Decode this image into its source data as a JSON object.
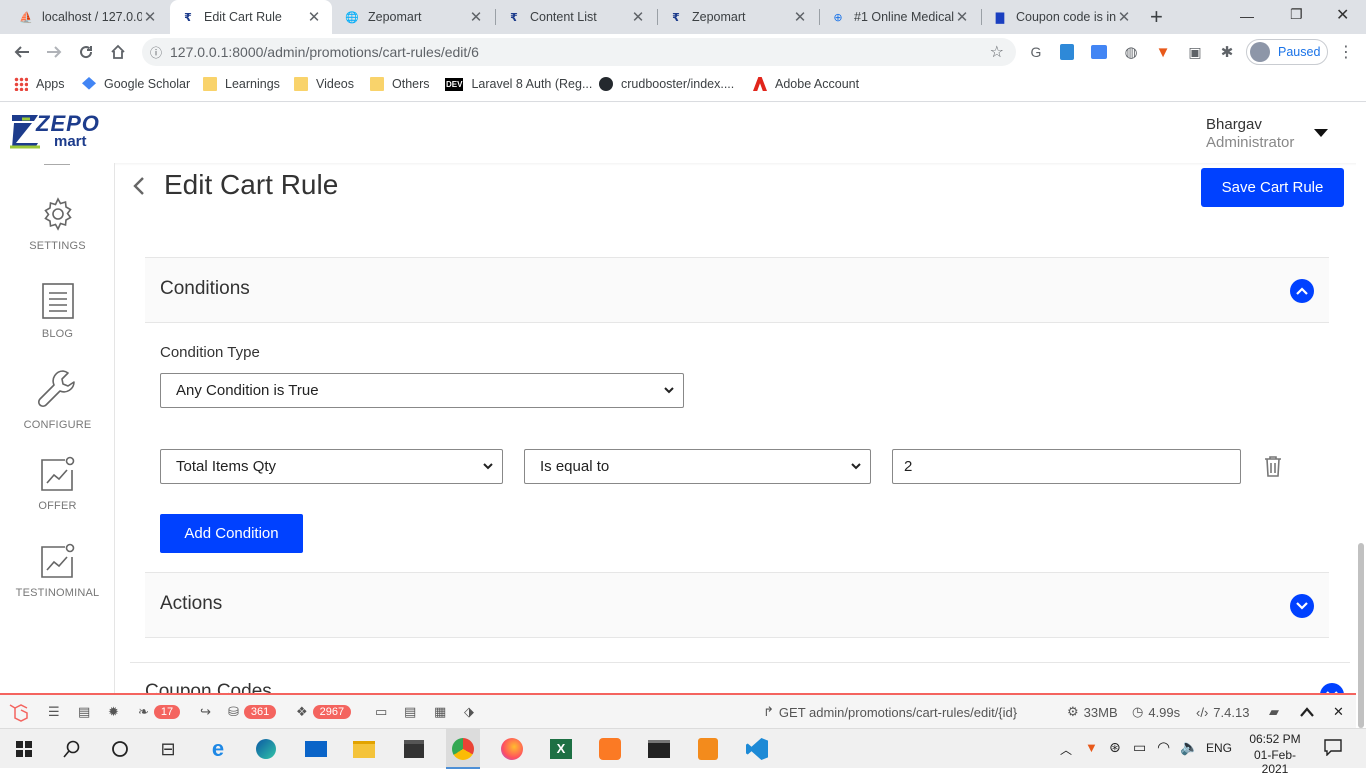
{
  "browser": {
    "tabs": [
      {
        "title": "localhost / 127.0.0."
      },
      {
        "title": "Edit Cart Rule"
      },
      {
        "title": "Zepomart"
      },
      {
        "title": "Content List"
      },
      {
        "title": "Zepomart"
      },
      {
        "title": "#1 Online Medical"
      },
      {
        "title": "Coupon code is in"
      }
    ],
    "new_tab_label": "+",
    "url": "127.0.0.1:8000/admin/promotions/cart-rules/edit/6",
    "profile_status": "Paused",
    "bookmarks": [
      {
        "label": "Apps"
      },
      {
        "label": "Google Scholar"
      },
      {
        "label": "Learnings"
      },
      {
        "label": "Videos"
      },
      {
        "label": "Others"
      },
      {
        "label": "Laravel 8 Auth (Reg..."
      },
      {
        "label": "crudbooster/index...."
      },
      {
        "label": "Adobe Account"
      }
    ],
    "dev_badge": "DEV"
  },
  "header": {
    "logo_text_top": "ZEPO",
    "logo_text_bottom": "mart",
    "user_name": "Bhargav",
    "user_role": "Administrator"
  },
  "sidebar": {
    "items": [
      {
        "label": "SETTINGS",
        "icon": "gear-icon"
      },
      {
        "label": "BLOG",
        "icon": "document-icon"
      },
      {
        "label": "CONFIGURE",
        "icon": "wrench-icon"
      },
      {
        "label": "OFFER",
        "icon": "chart-icon"
      },
      {
        "label": "TESTINOMINAL",
        "icon": "chart-icon"
      }
    ]
  },
  "page": {
    "title": "Edit Cart Rule",
    "save_button": "Save Cart Rule",
    "conditions_section": "Conditions",
    "condition_type_label": "Condition Type",
    "condition_type_value": "Any Condition is True",
    "condition_attribute": "Total Items Qty",
    "condition_operator": "Is equal to",
    "condition_value": "2",
    "add_condition_button": "Add Condition",
    "actions_section": "Actions",
    "coupon_section": "Coupon Codes"
  },
  "debugbar": {
    "messages_count": "17",
    "queries_count": "361",
    "models_count": "2967",
    "route": "GET admin/promotions/cart-rules/edit/{id}",
    "memory": "33MB",
    "time": "4.99s",
    "php_version": "7.4.13"
  },
  "taskbar": {
    "language": "ENG",
    "time": "06:52 PM",
    "date": "01-Feb-2021"
  },
  "colors": {
    "primary_blue": "#0041ff",
    "debug_red": "#f4645f"
  }
}
